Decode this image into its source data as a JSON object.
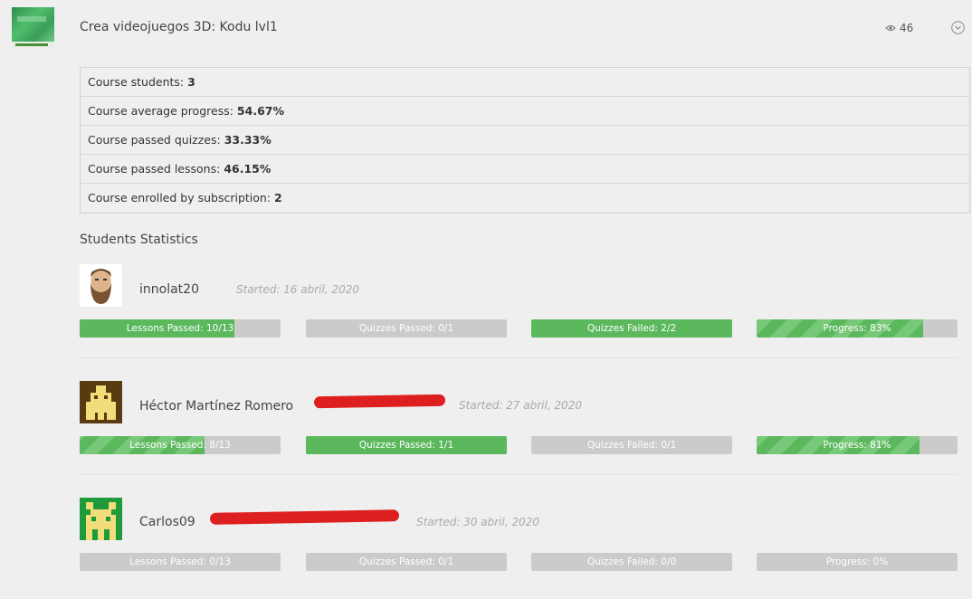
{
  "course": {
    "title": "Crea videojuegos 3D: Kodu lvl1",
    "views": "46",
    "thumbnail_icon": "kodu-course-thumbnail",
    "colors": {
      "accent_green": "#5bb85d",
      "bar_gray": "#cbcbcb",
      "redaction": "#dd1f1f"
    }
  },
  "course_stats": [
    {
      "label": "Course students:",
      "value": "3"
    },
    {
      "label": "Course average progress:",
      "value": "54.67%"
    },
    {
      "label": "Course passed quizzes:",
      "value": "33.33%"
    },
    {
      "label": "Course passed lessons:",
      "value": "46.15%"
    },
    {
      "label": "Course enrolled by subscription:",
      "value": "2"
    }
  ],
  "students_title": "Students Statistics",
  "students": [
    {
      "name": "innolat20",
      "started": "Started: 16 abril, 2020",
      "avatar_icon": "bearded-man-avatar",
      "bars": [
        {
          "label": "Lessons Passed: 10/13",
          "fill": 0.77,
          "striped": false
        },
        {
          "label": "Quizzes Passed: 0/1",
          "fill": 0,
          "striped": false
        },
        {
          "label": "Quizzes Failed: 2/2",
          "fill": 1,
          "striped": false
        },
        {
          "label": "Progress: 83%",
          "fill": 0.83,
          "striped": true
        }
      ]
    },
    {
      "name": "Héctor Martínez Romero",
      "started": "Started: 27 abril, 2020",
      "avatar_icon": "pixel-identicon-yellow",
      "bars": [
        {
          "label": "Lessons Passed: 8/13",
          "fill": 0.62,
          "striped": true
        },
        {
          "label": "Quizzes Passed: 1/1",
          "fill": 1,
          "striped": false
        },
        {
          "label": "Quizzes Failed: 0/1",
          "fill": 0,
          "striped": false
        },
        {
          "label": "Progress: 81%",
          "fill": 0.81,
          "striped": true
        }
      ]
    },
    {
      "name": "Carlos09",
      "started": "Started: 30 abril, 2020",
      "avatar_icon": "pixel-identicon-green",
      "bars": [
        {
          "label": "Lessons Passed: 0/13",
          "fill": 0,
          "striped": false
        },
        {
          "label": "Quizzes Passed: 0/1",
          "fill": 0,
          "striped": false
        },
        {
          "label": "Quizzes Failed: 0/0",
          "fill": 0,
          "striped": false
        },
        {
          "label": "Progress: 0%",
          "fill": 0,
          "striped": false
        }
      ]
    }
  ]
}
